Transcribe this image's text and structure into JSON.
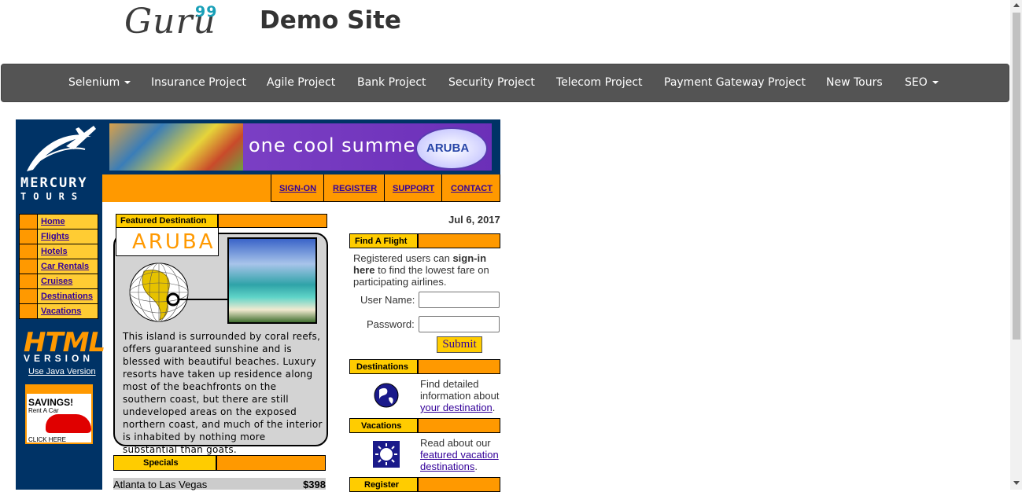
{
  "header": {
    "logo_text": "Guru",
    "logo_sup": "99",
    "site_title": "Demo Site"
  },
  "nav": [
    {
      "label": "Selenium",
      "dropdown": true
    },
    {
      "label": "Insurance Project"
    },
    {
      "label": "Agile Project"
    },
    {
      "label": "Bank Project"
    },
    {
      "label": "Security Project"
    },
    {
      "label": "Telecom Project"
    },
    {
      "label": "Payment Gateway Project"
    },
    {
      "label": "New Tours"
    },
    {
      "label": "SEO",
      "dropdown": true
    }
  ],
  "banner": {
    "text": "one cool summer",
    "badge": "ARUBA"
  },
  "top_links": [
    "SIGN-ON",
    "REGISTER",
    "SUPPORT",
    "CONTACT"
  ],
  "mercury": {
    "line1": "MERCURY",
    "line2": "TOURS"
  },
  "sidebar": [
    "Home",
    "Flights",
    "Hotels",
    "Car Rentals",
    "Cruises",
    "Destinations",
    "Vacations"
  ],
  "html_version": {
    "title": "HTML",
    "sub": "VERSION",
    "java_link": "Use Java Version"
  },
  "savings_ad": {
    "title": "SAVINGS!",
    "sub": "Rent A Car",
    "cta": "CLICK HERE"
  },
  "featured": {
    "header": "Featured Destination",
    "name": "ARUBA",
    "text": "This island is surrounded by coral reefs, offers guaranteed sunshine and is blessed with beautiful beaches. Luxury resorts have taken up residence along most of the beachfronts on the southern coast, but there are still undeveloped areas on the exposed northern coast, and much of the interior is inhabited by nothing more substantial than goats."
  },
  "specials": {
    "header": "Specials",
    "rows": [
      {
        "route": "Atlanta to Las Vegas",
        "price": "$398"
      }
    ]
  },
  "date": "Jul 6, 2017",
  "find_flight": {
    "header": "Find A Flight",
    "text_a": "Registered users can ",
    "text_bold": "sign-in here",
    "text_b": " to find the lowest fare on participating airlines.",
    "username_label": "User Name:",
    "password_label": "Password:",
    "submit": "Submit"
  },
  "destinations": {
    "header": "Destinations",
    "text": "Find detailed information about",
    "link": "your destination",
    "tail": "."
  },
  "vacations": {
    "header": "Vacations",
    "text": "Read about our",
    "link": "featured vacation destinations",
    "tail": "."
  },
  "register": {
    "header": "Register"
  },
  "colors": {
    "navy": "#003366",
    "orange": "#ff9900",
    "yellow": "#ffcc00",
    "link": "#330099",
    "navbar": "#545454"
  }
}
